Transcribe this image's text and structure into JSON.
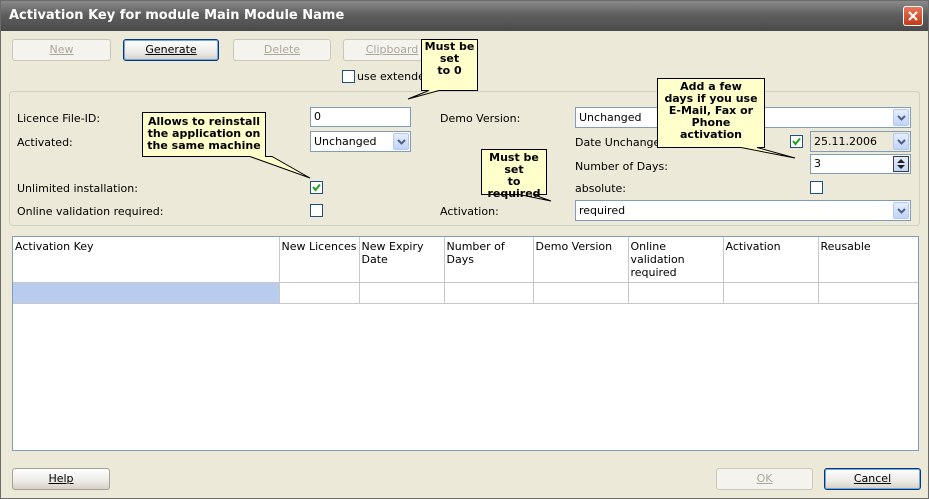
{
  "window": {
    "title": "Activation Key for module Main Module Name"
  },
  "toolbar": {
    "new_label": "New",
    "generate_label": "Generate",
    "delete_label": "Delete",
    "clipboard_label": "Clipboard",
    "use_extended_label": "use extended"
  },
  "form": {
    "licence_file_id_label": "Licence File-ID:",
    "licence_file_id_value": "0",
    "activated_label": "Activated:",
    "activated_value": "Unchanged",
    "unlimited_label": "Unlimited installation:",
    "unlimited_checked": true,
    "online_validation_label": "Online validation required:",
    "online_validation_checked": false,
    "demo_version_label": "Demo Version:",
    "demo_version_value": "Unchanged",
    "date_unchanged_label": "Date Unchanged",
    "date_unchanged_checked": true,
    "date_value": "25.11.2006",
    "number_of_days_label": "Number of Days:",
    "number_of_days_value": "3",
    "absolute_label": "absolute:",
    "absolute_checked": false,
    "activation_label": "Activation:",
    "activation_value": "required"
  },
  "table": {
    "columns": [
      "Activation Key",
      "New Licences",
      "New Expiry Date",
      "Number of Days",
      "Demo Version",
      "Online validation required",
      "Activation",
      "Reusable"
    ]
  },
  "callouts": {
    "must_be_zero": "Must be\nset\nto 0",
    "reinstall": "Allows to reinstall\nthe application on\nthe same machine",
    "must_be_required": "Must be\nset\nto required",
    "add_days": "Add a few\ndays if you use\nE-Mail, Fax or\nPhone\nactivation"
  },
  "footer": {
    "help_label": "Help",
    "ok_label": "OK",
    "cancel_label": "Cancel"
  },
  "colors": {
    "selection": "#b9cbee",
    "callout_fill": "#ffffcc"
  }
}
